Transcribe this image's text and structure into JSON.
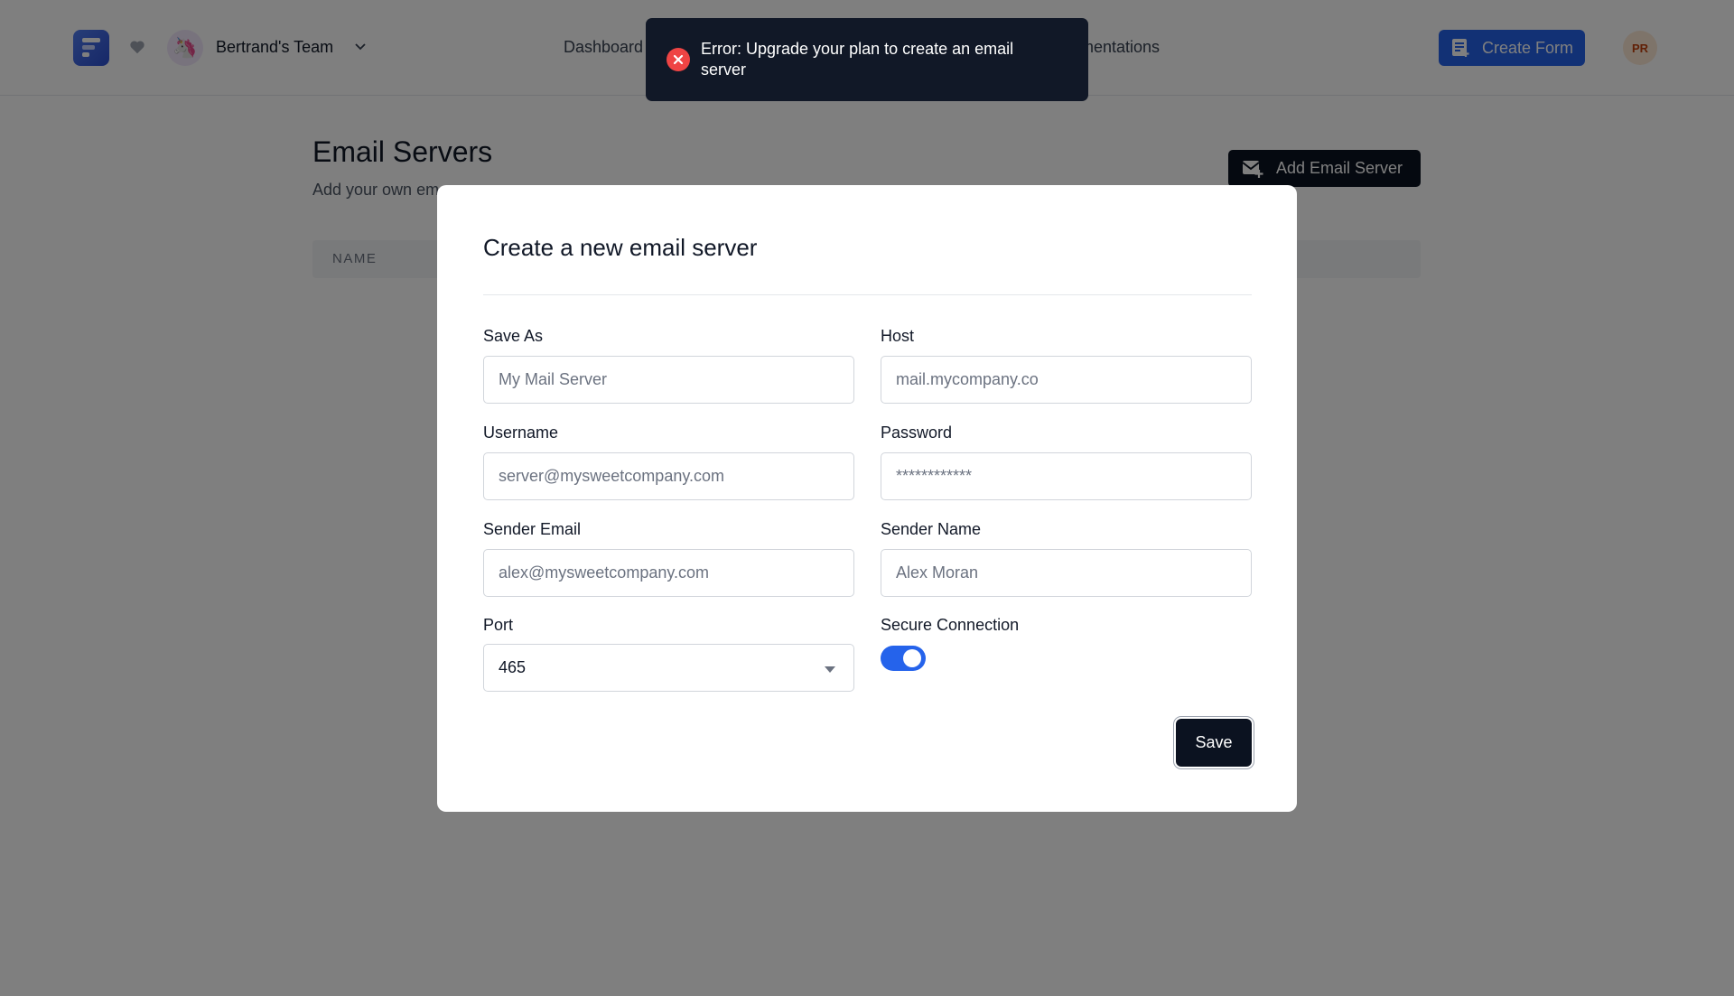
{
  "header": {
    "team_name": "Bertrand's Team",
    "nav": {
      "dashboard": "Dashboard",
      "docs_partial": "mentations"
    },
    "create_form_label": "Create Form",
    "user_initials": "PR"
  },
  "page": {
    "title": "Email Servers",
    "subtitle": "Add your own em",
    "add_button_label": "Add Email Server",
    "table_headers": [
      "NAME"
    ]
  },
  "toast": {
    "message": "Error: Upgrade your plan to create an email server",
    "color": "#ef4444"
  },
  "modal": {
    "title": "Create a new email server",
    "fields": {
      "save_as": {
        "label": "Save As",
        "placeholder": "My Mail Server"
      },
      "host": {
        "label": "Host",
        "placeholder": "mail.mycompany.co"
      },
      "username": {
        "label": "Username",
        "placeholder": "server@mysweetcompany.com"
      },
      "password": {
        "label": "Password",
        "placeholder": "************"
      },
      "sender_email": {
        "label": "Sender Email",
        "placeholder": "alex@mysweetcompany.com"
      },
      "sender_name": {
        "label": "Sender Name",
        "placeholder": "Alex Moran"
      },
      "port": {
        "label": "Port",
        "value": "465"
      },
      "secure_connection": {
        "label": "Secure Connection",
        "enabled": true
      }
    },
    "save_label": "Save"
  },
  "colors": {
    "primary": "#2563eb",
    "dark": "#0b1220"
  }
}
